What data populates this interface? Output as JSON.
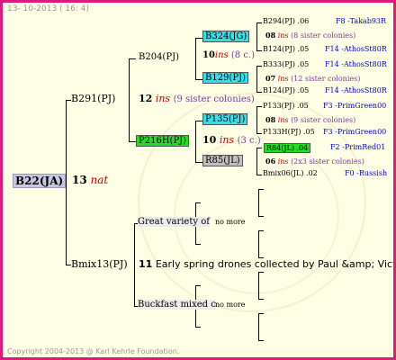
{
  "header": "13- 10-2013 ( 16: 4)",
  "footer": "Copyright 2004-2013 @ Karl Kehrle Foundation.",
  "root": {
    "name": "B22(JA)",
    "num": "13",
    "ins": "nat"
  },
  "gen1": [
    {
      "name": "B291(PJ)"
    },
    {
      "name": "Bmix13(PJ)",
      "num": "11",
      "note": "Early spring drones collected by Paul &amp; Victor"
    }
  ],
  "gen2": [
    {
      "name": "B204(PJ)",
      "num": "12",
      "ins": "ins",
      "sisters": "(9 sister colonies)"
    },
    {
      "name": "P216H(PJ)",
      "num": "10",
      "ins": "ins",
      "sisters": "(3 c.)"
    },
    {
      "name": "Great variety of",
      "more": "no more"
    },
    {
      "name": "Buckfast mixed c",
      "more": "no more"
    }
  ],
  "gen3": [
    {
      "name": "B324(JG)",
      "num": "10",
      "ins": "ins",
      "sisters": "(8 c.)"
    },
    {
      "name": "B129(PJ)"
    },
    {
      "name": "P135(PJ)"
    },
    {
      "name": "R85(JL)"
    }
  ],
  "gen4": [
    {
      "name": "B294(PJ)",
      "val": ".06",
      "link": "F8 -Takab93R"
    },
    {
      "num": "08",
      "ins": "ins",
      "note": "(8 sister colonies)"
    },
    {
      "name": "B124(PJ)",
      "val": ".05",
      "link": "F14 -AthosSt80R"
    },
    {
      "name": "B333(PJ)",
      "val": ".05",
      "link": "F14 -AthosSt80R"
    },
    {
      "num": "07",
      "ins": "ins",
      "note": "(12 sister colonies)"
    },
    {
      "name": "B124(PJ)",
      "val": ".05",
      "link": "F14 -AthosSt80R"
    },
    {
      "name": "P133(PJ)",
      "val": ".05",
      "link": "F3 -PrimGreen00"
    },
    {
      "num": "08",
      "ins": "ins",
      "note": "(9 sister colonies)"
    },
    {
      "name": "P133H(PJ)",
      "val": ".05",
      "link": "F3 -PrimGreen00"
    },
    {
      "name": "R84(JL)",
      "val": ".04",
      "link": "F2 -PrimRed01"
    },
    {
      "num": "06",
      "ins": "ins",
      "note": "(2x3 sister colonies)"
    },
    {
      "name": "Bmix06(JL)",
      "val": ".02",
      "link": "F0 -Russish"
    }
  ],
  "colors": {
    "border": "#e0197d",
    "background": "#fefee4",
    "cyan": "#33e0e8",
    "green": "#22dd22",
    "grey": "#c0c0c0",
    "root_box": "#c8c8e0"
  }
}
